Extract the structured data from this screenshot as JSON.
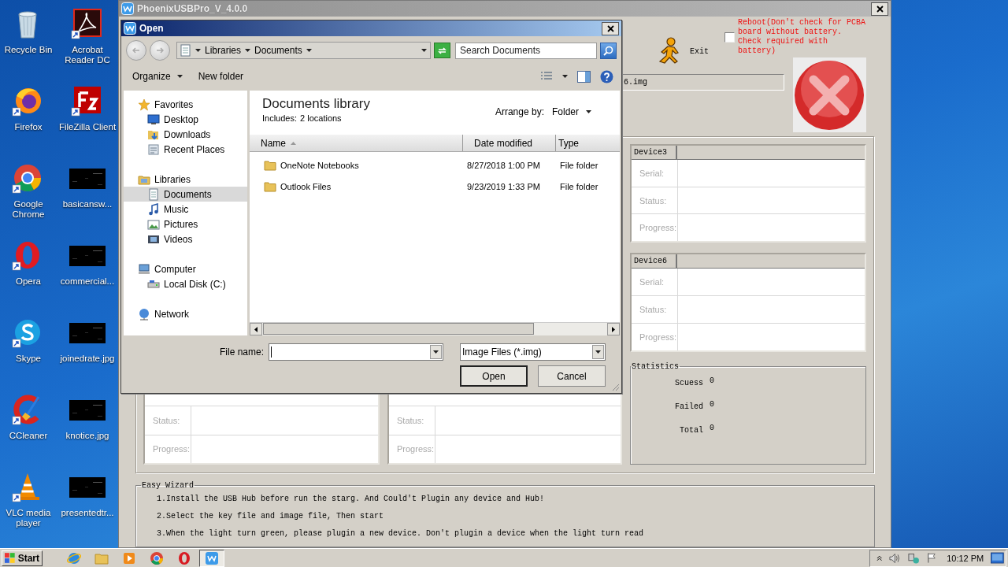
{
  "desktop_icons": [
    {
      "label": "Recycle Bin",
      "kind": "recycle",
      "shortcut": false
    },
    {
      "label": "Acrobat Reader DC",
      "kind": "acrobat",
      "shortcut": true
    },
    {
      "label": "Firefox",
      "kind": "firefox",
      "shortcut": true
    },
    {
      "label": "FileZilla Client",
      "kind": "filezilla",
      "shortcut": true
    },
    {
      "label": "Google Chrome",
      "kind": "chrome",
      "shortcut": true
    },
    {
      "label": "basicansw...",
      "kind": "thumbnail",
      "shortcut": false
    },
    {
      "label": "Opera",
      "kind": "opera",
      "shortcut": true
    },
    {
      "label": "commercial...",
      "kind": "thumbnail",
      "shortcut": false
    },
    {
      "label": "Skype",
      "kind": "skype",
      "shortcut": true
    },
    {
      "label": "joinedrate.jpg",
      "kind": "thumbnail",
      "shortcut": false
    },
    {
      "label": "CCleaner",
      "kind": "ccleaner",
      "shortcut": true
    },
    {
      "label": "knotice.jpg",
      "kind": "thumbnail",
      "shortcut": false
    },
    {
      "label": "VLC media player",
      "kind": "vlc",
      "shortcut": true
    },
    {
      "label": "presentedtr...",
      "kind": "thumbnail",
      "shortcut": false
    }
  ],
  "main_window": {
    "title": "PhoenixUSBPro_V_4.0.0",
    "exit_button": "Exit",
    "reboot": {
      "label": "Reboot(Don't check for PCBA board without battery. Check required with battery)",
      "checked": false
    },
    "image_field": "6.img",
    "devices": [
      {
        "title": "Device3",
        "rows": [
          "Serial:",
          "Status:",
          "Progress:"
        ]
      },
      {
        "title": "Device6",
        "rows": [
          "Serial:",
          "Status:",
          "Progress:"
        ]
      }
    ],
    "covered_devices": [
      {
        "rows": [
          "Status:",
          "Progress:"
        ]
      },
      {
        "rows": [
          "Status:",
          "Progress:"
        ]
      }
    ],
    "statistics": {
      "title": "Statistics",
      "rows": [
        {
          "label": "Scuess",
          "value": "0"
        },
        {
          "label": "Failed",
          "value": "0"
        },
        {
          "label": "Total",
          "value": "0"
        }
      ]
    },
    "wizard": {
      "title": "Easy Wizard",
      "steps": [
        "1.Install the USB Hub before run the starg. And Could't Plugin any device and Hub!",
        "2.Select the key file and image file, Then start",
        "3.When the light turn green, please plugin a new device. Don't plugin a device when the light turn read"
      ]
    }
  },
  "open_dialog": {
    "title": "Open",
    "breadcrumb": [
      "Libraries",
      "Documents"
    ],
    "search": {
      "placeholder": "Search Documents"
    },
    "toolbar": [
      {
        "label": "Organize",
        "dropdown": true
      },
      {
        "label": "New folder",
        "dropdown": false
      }
    ],
    "nav": [
      {
        "label": "Favorites",
        "kind": "star",
        "selected": false,
        "children": [
          {
            "label": "Desktop",
            "kind": "desktop",
            "selected": false
          },
          {
            "label": "Downloads",
            "kind": "downloads",
            "selected": false
          },
          {
            "label": "Recent Places",
            "kind": "recent",
            "selected": false
          }
        ]
      },
      {
        "label": "Libraries",
        "kind": "library",
        "selected": false,
        "children": [
          {
            "label": "Documents",
            "kind": "documents",
            "selected": true
          },
          {
            "label": "Music",
            "kind": "music",
            "selected": false
          },
          {
            "label": "Pictures",
            "kind": "pictures",
            "selected": false
          },
          {
            "label": "Videos",
            "kind": "videos",
            "selected": false
          }
        ]
      },
      {
        "label": "Computer",
        "kind": "computer",
        "selected": false,
        "children": [
          {
            "label": "Local Disk (C:)",
            "kind": "disk",
            "selected": false
          }
        ]
      },
      {
        "label": "Network",
        "kind": "network",
        "selected": false
      }
    ],
    "library": {
      "title": "Documents library",
      "includes_label": "Includes:",
      "includes_value": "2 locations",
      "arrange_label": "Arrange by:",
      "arrange_value": "Folder"
    },
    "columns": [
      {
        "label": "Name",
        "sorted": true
      },
      {
        "label": "Date modified",
        "sorted": false
      },
      {
        "label": "Type",
        "sorted": false
      }
    ],
    "files": [
      {
        "name": "OneNote Notebooks",
        "date": "8/27/2018 1:00 PM",
        "type": "File folder"
      },
      {
        "name": "Outlook Files",
        "date": "9/23/2019 1:33 PM",
        "type": "File folder"
      }
    ],
    "file_name_label": "File name:",
    "file_type": "Image Files (*.img)",
    "buttons": [
      {
        "label": "Open",
        "default": true
      },
      {
        "label": "Cancel",
        "default": false
      }
    ]
  },
  "taskbar": {
    "start": "Start",
    "apps": [
      {
        "kind": "ie",
        "active": false
      },
      {
        "kind": "explorer",
        "active": false
      },
      {
        "kind": "media",
        "active": false
      },
      {
        "kind": "chrome",
        "active": false
      },
      {
        "kind": "opera",
        "active": false
      },
      {
        "kind": "phoenix",
        "active": true
      }
    ],
    "clock": "10:12 PM"
  }
}
